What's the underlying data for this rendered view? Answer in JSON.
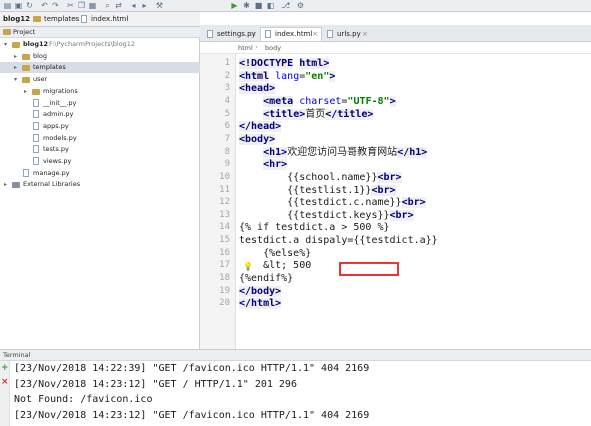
{
  "toolbar": {
    "icons": [
      "open-icon",
      "save-icon",
      "sync-icon",
      "undo-icon",
      "redo-icon",
      "cut-icon",
      "copy-icon",
      "paste-icon",
      "find-icon",
      "replace-icon",
      "back-icon",
      "forward-icon",
      "build-icon",
      "run-icon",
      "debug-icon",
      "stop-icon",
      "coverage-icon",
      "vcs-icon",
      "settings-icon"
    ]
  },
  "navbar": {
    "crumbs": [
      "blog12",
      "templates",
      "index.html"
    ]
  },
  "tabs": [
    {
      "label": "settings.py",
      "active": false
    },
    {
      "label": "index.html",
      "active": true
    },
    {
      "label": "urls.py",
      "active": false
    }
  ],
  "sidebar": {
    "header": "Project",
    "tree": [
      {
        "label": "blog12",
        "path": "F:\\PycharmProjects\\blog12",
        "level": 0,
        "type": "folder",
        "expanded": true
      },
      {
        "label": "blog",
        "level": 1,
        "type": "folder",
        "expanded": false
      },
      {
        "label": "templates",
        "level": 1,
        "type": "folder",
        "expanded": false,
        "selected": true
      },
      {
        "label": "user",
        "level": 1,
        "type": "folder",
        "expanded": true
      },
      {
        "label": "migrations",
        "level": 2,
        "type": "folder",
        "expanded": false
      },
      {
        "label": "__init__.py",
        "level": 2,
        "type": "file"
      },
      {
        "label": "admin.py",
        "level": 2,
        "type": "file"
      },
      {
        "label": "apps.py",
        "level": 2,
        "type": "file"
      },
      {
        "label": "models.py",
        "level": 2,
        "type": "file"
      },
      {
        "label": "tests.py",
        "level": 2,
        "type": "file"
      },
      {
        "label": "views.py",
        "level": 2,
        "type": "file"
      },
      {
        "label": "manage.py",
        "level": 1,
        "type": "file"
      },
      {
        "label": "External Libraries",
        "level": 0,
        "type": "library",
        "expanded": false
      }
    ]
  },
  "editor": {
    "breadcrumb": [
      "html",
      "body"
    ],
    "lines": [
      {
        "n": "1",
        "text": "<!DOCTYPE html>"
      },
      {
        "n": "2",
        "text": "<html lang=\"en\">"
      },
      {
        "n": "3",
        "text": "<head>"
      },
      {
        "n": "4",
        "text": "    <meta charset=\"UTF-8\">"
      },
      {
        "n": "5",
        "text": "    <title>首页</title>"
      },
      {
        "n": "6",
        "text": "</head>"
      },
      {
        "n": "7",
        "text": "<body>"
      },
      {
        "n": "8",
        "text": "    <h1>欢迎您访问马哥教育网站</h1>"
      },
      {
        "n": "9",
        "text": "    <hr>"
      },
      {
        "n": "10",
        "text": "        {{school.name}}<br>"
      },
      {
        "n": "11",
        "text": "        {{testlist.1}}<br>"
      },
      {
        "n": "12",
        "text": "        {{testdict.c.name}}<br>"
      },
      {
        "n": "13",
        "text": "        {{testdict.keys}}<br>"
      },
      {
        "n": "14",
        "text": "{% if testdict.a > 500 %}"
      },
      {
        "n": "15",
        "text": "testdict.a dispaly={{testdict.a}}"
      },
      {
        "n": "16",
        "text": "    {%else%}"
      },
      {
        "n": "17",
        "text": "    &lt; 500"
      },
      {
        "n": "18",
        "text": "{%endif%}"
      },
      {
        "n": "19",
        "text": "</body>"
      },
      {
        "n": "20",
        "text": "</html>"
      }
    ]
  },
  "terminal": {
    "header": "Terminal",
    "lines": [
      "[23/Nov/2018 14:22:39] \"GET /favicon.ico HTTP/1.1\" 404 2169",
      "[23/Nov/2018 14:23:12] \"GET / HTTP/1.1\" 201 296",
      "Not Found: /favicon.ico",
      "[23/Nov/2018 14:23:12] \"GET /favicon.ico HTTP/1.1\" 404 2169"
    ],
    "side_icons": [
      "+",
      "×"
    ]
  },
  "colors": {
    "tag": "#000080",
    "attr": "#0000ff",
    "string": "#008000",
    "highlight_box": "#ee3333"
  }
}
